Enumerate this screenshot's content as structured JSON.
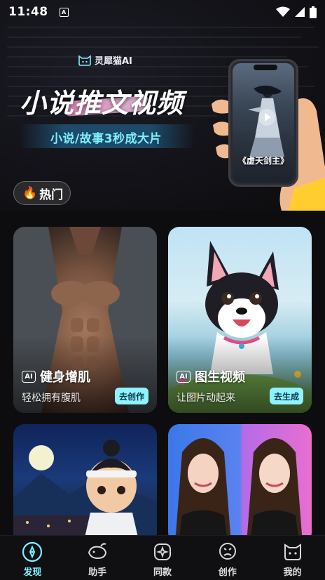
{
  "status": {
    "time": "11:48",
    "a_icon": "A"
  },
  "hero": {
    "brand": "灵犀猫AI",
    "title": "小说推文视频",
    "subtitle": "小说/故事3秒成大片",
    "phone_caption": "《虚天剑主》"
  },
  "hot_chip": {
    "label": "热门",
    "emoji": "🔥"
  },
  "cards": [
    {
      "badge": "AI",
      "title": "健身增肌",
      "desc": "轻松拥有腹肌",
      "button": "去创作"
    },
    {
      "badge": "AI",
      "title": "图生视频",
      "desc": "让图片动起来",
      "button": "去生成"
    }
  ],
  "tabbar": {
    "items": [
      {
        "label": "发现",
        "icon": "compass-icon",
        "active": true
      },
      {
        "label": "助手",
        "icon": "whale-icon",
        "active": false
      },
      {
        "label": "同款",
        "icon": "sparkle-box-icon",
        "active": false
      },
      {
        "label": "创作",
        "icon": "smile-bubble-icon",
        "active": false
      },
      {
        "label": "我的",
        "icon": "cat-face-icon",
        "active": false
      }
    ]
  },
  "colors": {
    "accent": "#7ff0ff",
    "background": "#0d0d0f",
    "button_bg": "#8ff3ff"
  }
}
